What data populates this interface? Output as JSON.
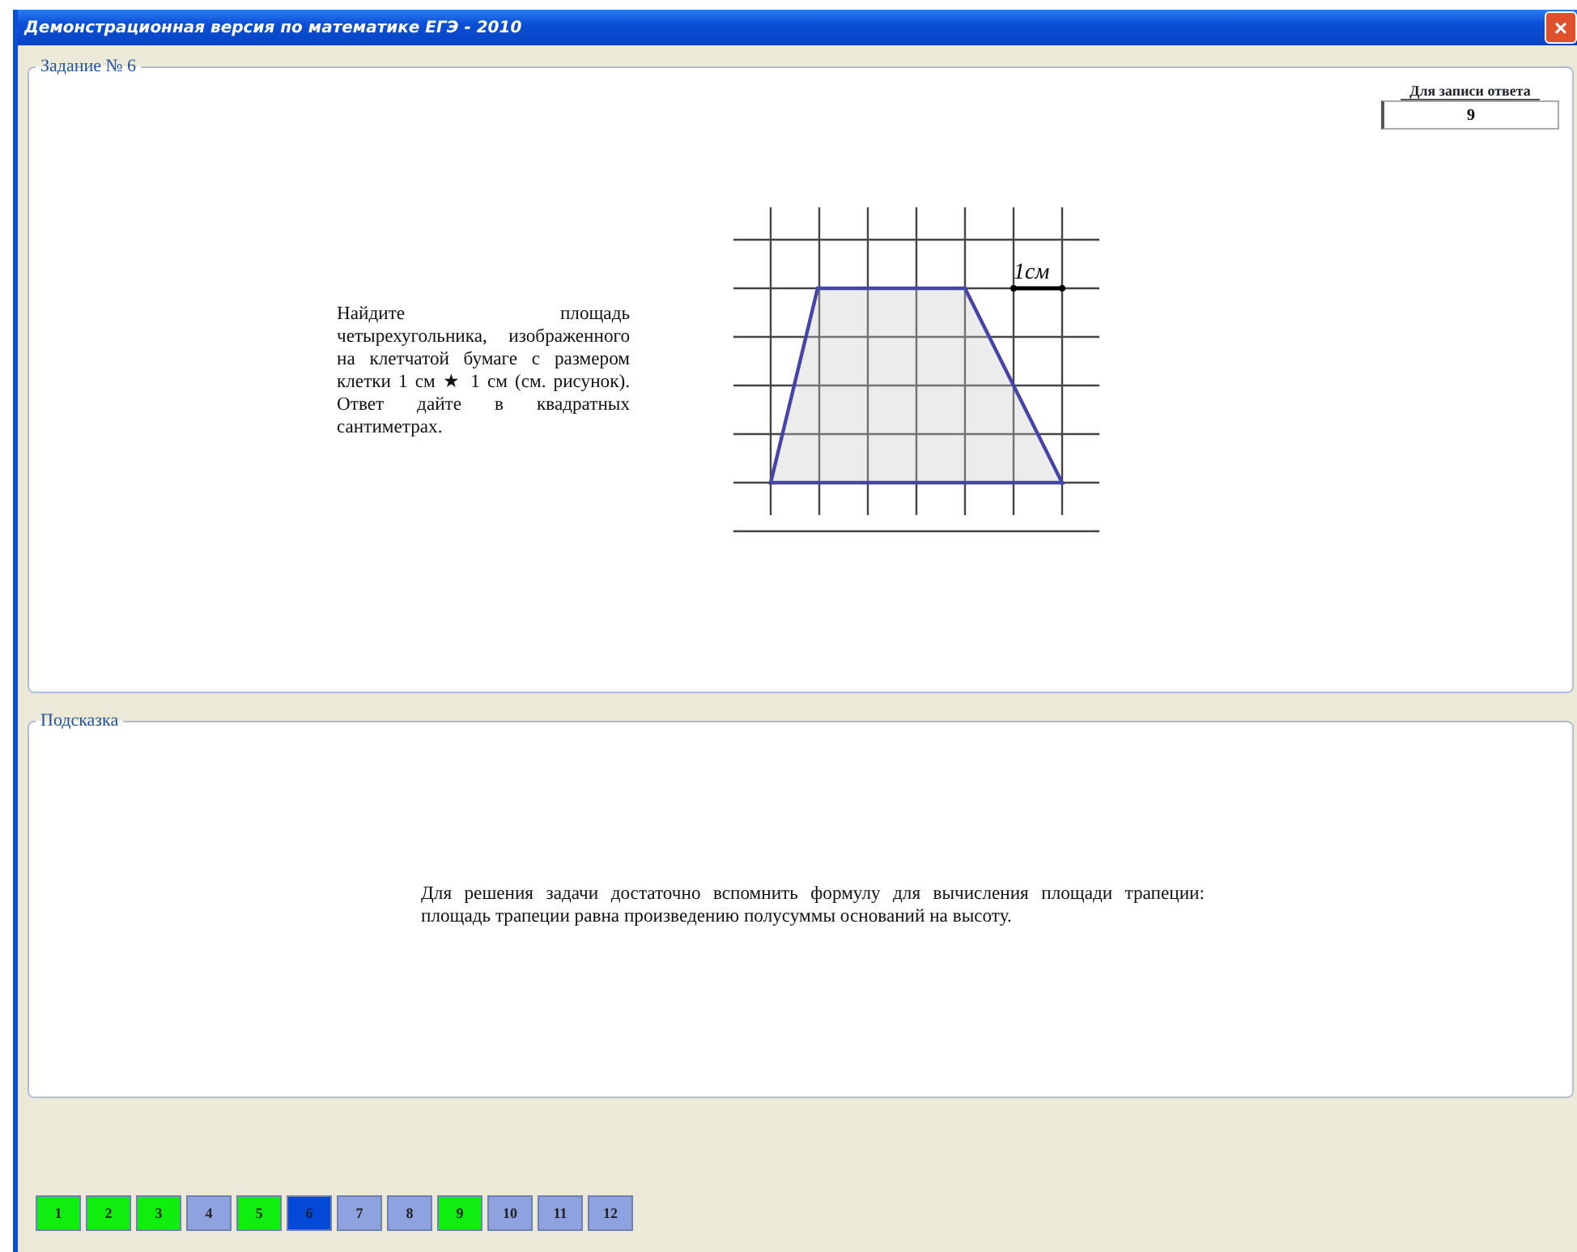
{
  "window": {
    "title": "Демонстрационная версия по математике ЕГЭ - 2010",
    "close": "×"
  },
  "task": {
    "legend": "Задание № 6",
    "answer": {
      "label": "Для записи ответа",
      "value": "9"
    },
    "text": "Найдите площадь четырехугольника, изображенного на клетчатой бумаге с размером клетки 1 см ★ 1 см (см. рисунок). Ответ дайте в квадратных сантиметрах.",
    "figure": {
      "scale_label": "1см"
    }
  },
  "hint": {
    "legend": "Подсказка",
    "text": "Для решения задачи достаточно вспомнить формулу для вычисления площади трапеции: площадь трапеции равна произведению полусуммы оснований на высоту."
  },
  "questions": [
    {
      "label": "1",
      "selected": false,
      "answered": true
    },
    {
      "label": "2",
      "selected": false,
      "answered": true
    },
    {
      "label": "3",
      "selected": false,
      "answered": true
    },
    {
      "label": "4",
      "selected": false,
      "answered": false
    },
    {
      "label": "5",
      "selected": false,
      "answered": true
    },
    {
      "label": "6",
      "selected": true,
      "answered": false
    },
    {
      "label": "7",
      "selected": false,
      "answered": false
    },
    {
      "label": "8",
      "selected": false,
      "answered": false
    },
    {
      "label": "9",
      "selected": false,
      "answered": true
    },
    {
      "label": "10",
      "selected": false,
      "answered": false
    },
    {
      "label": "11",
      "selected": false,
      "answered": false
    },
    {
      "label": "12",
      "selected": false,
      "answered": false
    }
  ]
}
